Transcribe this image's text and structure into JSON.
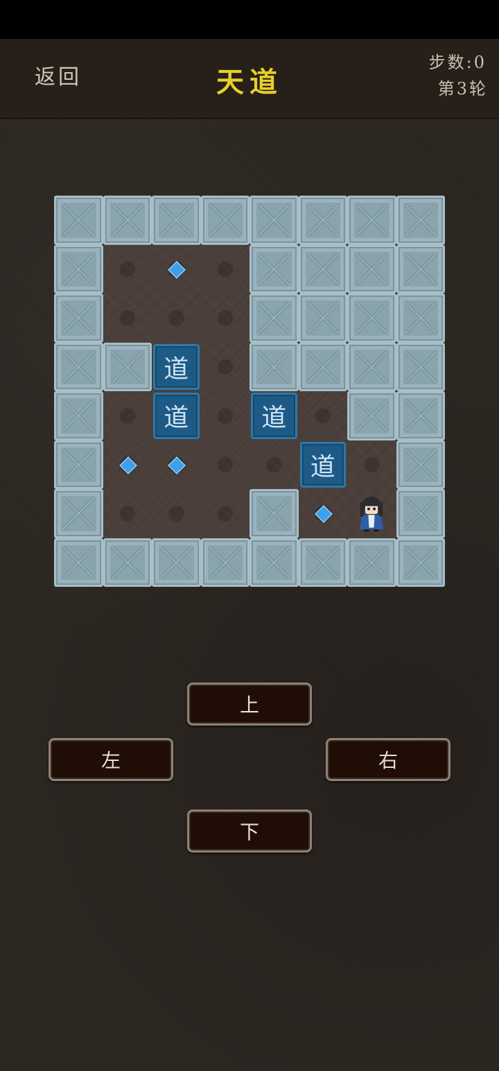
{
  "header": {
    "back_label": "返回",
    "title": "天道",
    "steps_label": "步数:0",
    "round_label": "第3轮"
  },
  "board": {
    "rows": 8,
    "cols": 8,
    "legend": {
      "W": "wall",
      ".": "floor",
      "T": "target",
      "B": "box",
      "P": "player"
    },
    "grid": [
      "WWWWWWWW",
      "W.T.WWWW",
      "W...WWWW",
      "WWB.WWWW",
      "W.B.B.WW",
      "WTT..B.W",
      "W...WT.PW",
      "WWWWWWWW"
    ],
    "box_label": "道",
    "colors": {
      "wall": "#8aa4ad",
      "floor": "#4a3f3a",
      "box": "#1e5a86",
      "target": "#3aa0ef"
    }
  },
  "controls": {
    "up_label": "上",
    "left_label": "左",
    "right_label": "右",
    "down_label": "下"
  },
  "colors": {
    "title": "#e8cf2a",
    "background": "#2b2520"
  }
}
